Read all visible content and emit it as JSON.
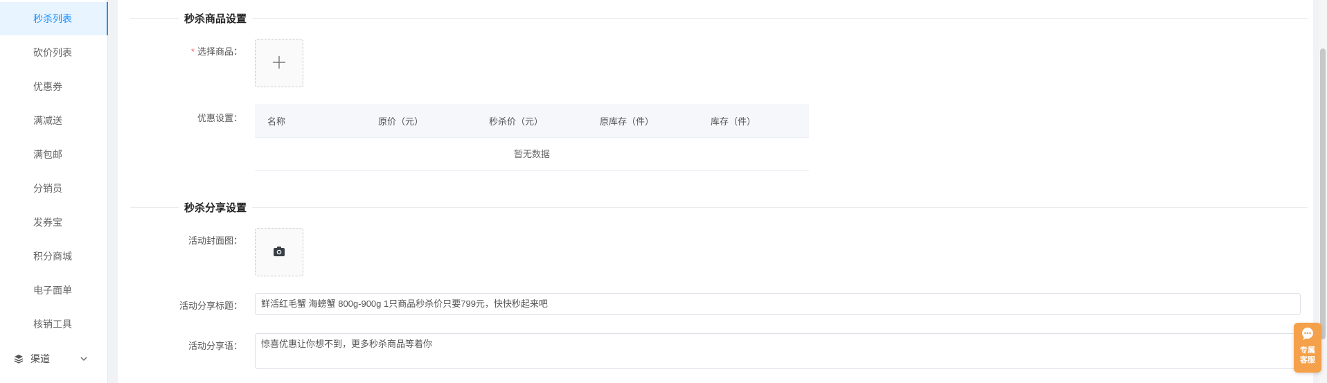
{
  "sidebar": {
    "items": [
      {
        "label": "秒杀列表",
        "active": true
      },
      {
        "label": "砍价列表",
        "active": false
      },
      {
        "label": "优惠券",
        "active": false
      },
      {
        "label": "满减送",
        "active": false
      },
      {
        "label": "满包邮",
        "active": false
      },
      {
        "label": "分销员",
        "active": false
      },
      {
        "label": "发券宝",
        "active": false
      },
      {
        "label": "积分商城",
        "active": false
      },
      {
        "label": "电子面单",
        "active": false
      },
      {
        "label": "核销工具",
        "active": false
      }
    ],
    "group": {
      "label": "渠道",
      "icon": "layers-icon",
      "expand_icon": "chevron-down-icon"
    }
  },
  "goods_section": {
    "title": "秒杀商品设置",
    "select_label": "选择商品：",
    "required_mark": "*",
    "discount_label": "优惠设置：",
    "table": {
      "columns": [
        "名称",
        "原价（元）",
        "秒杀价（元）",
        "原库存（件）",
        "库存（件）"
      ],
      "empty_text": "暂无数据"
    }
  },
  "share_section": {
    "title": "秒杀分享设置",
    "cover_label": "活动封面图：",
    "share_title_label": "活动分享标题：",
    "share_title_value": "鲜活红毛蟹 海螃蟹 800g-900g 1只商品秒杀价只要799元，快快秒起来吧",
    "share_text_label": "活动分享语：",
    "share_text_value": "惊喜优惠让你想不到，更多秒杀商品等着你"
  },
  "service_widget": {
    "line1": "专属",
    "line2": "客服",
    "icon": "chat-icon"
  },
  "colors": {
    "primary": "#1890ff",
    "required": "#f56c6c",
    "service": "#f5a04a"
  }
}
